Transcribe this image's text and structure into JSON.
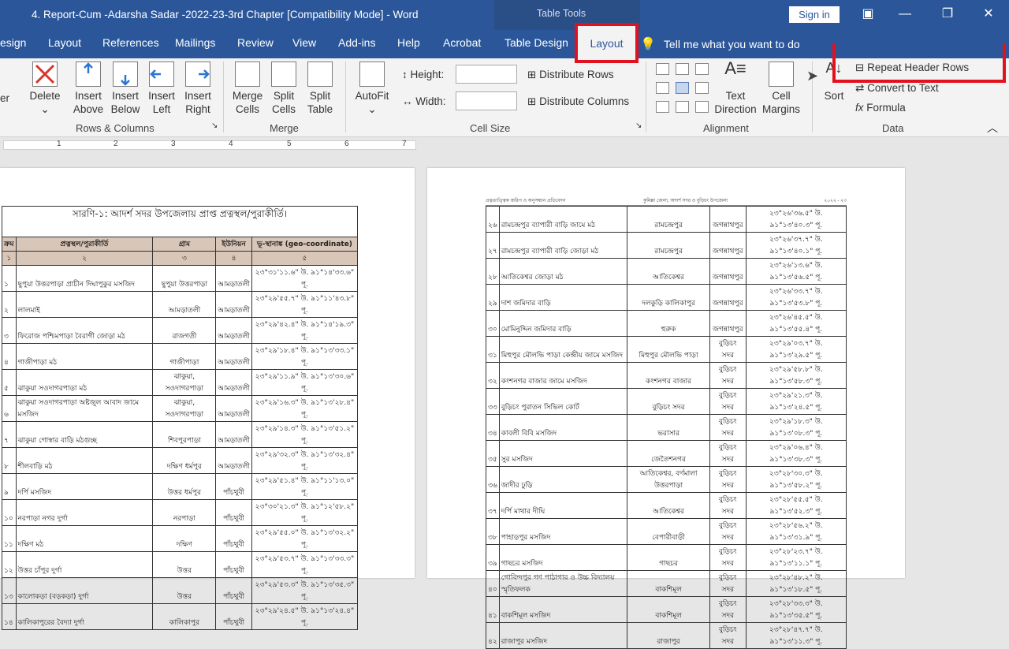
{
  "window": {
    "title": "4. Report-Cum -Adarsha Sadar -2022-23-3rd Chapter [Compatibility Mode]  -  Word",
    "table_tools": "Table Tools",
    "signin": "Sign in"
  },
  "tabs": [
    "esign",
    "Layout",
    "References",
    "Mailings",
    "Review",
    "View",
    "Add-ins",
    "Help",
    "Acrobat",
    "Table Design"
  ],
  "active_tab": "Layout",
  "tellme": "Tell me what you want to do",
  "ribbon": {
    "partial_left": "er",
    "delete": "Delete",
    "insert_above": [
      "Insert",
      "Above"
    ],
    "insert_below": [
      "Insert",
      "Below"
    ],
    "insert_left": [
      "Insert",
      "Left"
    ],
    "insert_right": [
      "Insert",
      "Right"
    ],
    "grp_rows": "Rows & Columns",
    "merge_cells": [
      "Merge",
      "Cells"
    ],
    "split_cells": [
      "Split",
      "Cells"
    ],
    "split_table": [
      "Split",
      "Table"
    ],
    "grp_merge": "Merge",
    "autofit": "AutoFit",
    "height_lbl": "Height:",
    "width_lbl": "Width:",
    "distribute_rows": "Distribute Rows",
    "distribute_cols": "Distribute Columns",
    "grp_cellsize": "Cell Size",
    "text_direction": [
      "Text",
      "Direction"
    ],
    "cell_margins": [
      "Cell",
      "Margins"
    ],
    "grp_alignment": "Alignment",
    "sort": "Sort",
    "repeat_header": "Repeat Header Rows",
    "convert_text": "Convert to Text",
    "formula": "Formula",
    "grp_data": "Data"
  },
  "ruler_ticks": [
    "1",
    "2",
    "3",
    "4",
    "5",
    "6",
    "7"
  ],
  "left_doc": {
    "caption": "সারণি-১: আদর্শ সদর উপজেলায় প্রাপ্ত প্রত্নস্থল/পুরাকীর্তি।",
    "headers": [
      "ক্রম",
      "প্রত্নস্থল/পুরাকীর্তি",
      "গ্রাম",
      "ইউনিয়ন",
      "ভূ-স্থানাঙ্ক (geo-coordinate)"
    ],
    "numrow": [
      "১",
      "২",
      "৩",
      "৪",
      "৫"
    ],
    "rows": [
      [
        "১",
        "ছুপুয়া উত্তরপাড়া প্রাচীন দিঘাপুকুর মসজিদ",
        "ছুপুয়া উত্তরপাড়া",
        "আমড়াতলী",
        "২৩°৩১'১১.৬\" উ. ৯১°১৪'৩৩.৬\" পূ."
      ],
      [
        "২",
        "লালমাই",
        "আমড়াতলী",
        "আমড়াতলী",
        "২৩°২৯'৫৫.৭\" উ. ৯১°১১'৪৩.৮\" পূ."
      ],
      [
        "৩",
        "ফিরোজ পশ্চিমপাড়া বৈরাগী জোড়া মঠ",
        "রাজগতী",
        "আমড়াতলী",
        "২৩°২৯'৪২.৪\" উ. ৯১°১৪'১৯.৩\" পূ."
      ],
      [
        "৪",
        "গাজীপাড়া মঠ",
        "গাজীপাড়া",
        "আমড়াতলী",
        "২৩°২৯'১৮.৪\" উ. ৯১°১৩'৩৩.১\" পূ."
      ],
      [
        "৫",
        "ঝাকুয়া সওদাগরপাড়া মঠ",
        "ঝাকুয়া, সওদাগরপাড়া",
        "আমড়াতলী",
        "২৩°২৯'১১.৯\" উ. ৯১°১৩'৩০.৬\" পূ."
      ],
      [
        "৬",
        "ঝাকুয়া সওদাগরপাড়া অষ্টজুল আবাদ জামে মসজিদ",
        "ঝাকুয়া, সওদাগরপাড়া",
        "আমড়াতলী",
        "২৩°২৯'১৬.৩\" উ. ৯১°১৩'২৮.৪\" পূ."
      ],
      [
        "৭",
        "ঝাকুয়া গোস্বার বাড়ি মঠগুচ্ছ",
        "শিবপুরপাড়া",
        "আমড়াতলী",
        "২৩°২৯'১৪.৩\" উ. ৯১°১৩'৫১.২\" পূ."
      ],
      [
        "৮",
        "শীলবাড়ি মঠ",
        "দক্ষিণ ধর্মপুর",
        "আমড়াতলী",
        "২৩°২৯'৩২.৩\" উ. ৯১°১৩'৩২.৪\" পূ."
      ],
      [
        "৯",
        "দর্পি মসজিদ",
        "উত্তর ধর্মপুর",
        "পাঁচথুবী",
        "২৩°২৯'৫১.৪\" উ. ৯১°১১'১৩.০\" পূ."
      ],
      [
        "১০",
        "নরপাড়া নগর দুর্গা",
        "নরপাড়া",
        "পাঁচথুবী",
        "২৩°৩০'২১.৩\" উ. ৯১°১২'৫৮.২\" পূ."
      ],
      [
        "১১",
        "দক্ষিণ মঠ",
        "দক্ষিণ",
        "পাঁচথুবী",
        "২৩°২৯'৫৫.০\" উ. ৯১°১৩'৩২.২\" পূ."
      ],
      [
        "১২",
        "উত্তর চাঁপুর দুর্গা",
        "উত্তর",
        "পাঁচথুবী",
        "২৩°২৯'৫৩.৭\" উ. ৯১°১৩'৩৩.৩\" পূ."
      ],
      [
        "১৩",
        "কালোকড়া (বড়কড়া) দুর্গা",
        "উত্তর",
        "পাঁচথুবী",
        "২৩°২৯'৫৩.৩\" উ. ৯১°১৩'৩৫.৩\" পূ."
      ],
      [
        "১৪",
        "কালিকাপুরের বৈদ্যা দুর্গা",
        "কালিকাপুর",
        "পাঁচথুবী",
        "২৩°২৯'২৪.৫\" উ. ৯১°১৩'২৪.৪\" পূ."
      ]
    ]
  },
  "right_doc": {
    "header_left": "প্রত্নতাত্ত্বিক জরিপ ও অনুসন্ধান প্রতিবেদন",
    "header_mid": "কুমিল্লা জেলা, আদর্শ সদর ও বুড়িচং উপজেলা",
    "header_right": "২০২২ - ২৩",
    "rows": [
      [
        "২৬",
        "রামচন্দ্রপুর ব্যাপারী বাড়ি জামে মঠ",
        "রামচন্দ্রপুর",
        "জগন্নাথপুর",
        "২৩°২৬'৩৬.৫\" উ. ৯১°১৩'৪০.৩\" পূ."
      ],
      [
        "২৭",
        "রামচন্দ্রপুর ব্যাপারী বাড়ি জোড়া মঠ",
        "রামচন্দ্রপুর",
        "জগন্নাথপুর",
        "২৩°২৬'৩৭.৭\" উ. ৯১°১৩'৪০.১\" পূ."
      ],
      [
        "২৮",
        "আতিকেশ্বর জোড়া মঠ",
        "আতিকেশ্বর",
        "জগন্নাথপুর",
        "২৩°২৬'১৩.৬\" উ. ৯১°১৩'৫৬.৫\" পূ."
      ],
      [
        "২৯",
        "দাশ জমিদার বাড়ি",
        "দলকুড়ি কালিকাপুর",
        "জগন্নাথপুর",
        "২৩°২৬'৩৩.৭\" উ. ৯১°১৩'৫৩.৮\" পূ."
      ],
      [
        "৩০",
        "মোমিনুদ্দিন জমিদার বাড়ি",
        "হুরুক",
        "জগন্নাথপুর",
        "২৩°২৬'৪৫.৫\" উ. ৯১°১৩'৫৫.৪\" পূ."
      ],
      [
        "৩১",
        "মিহুপুর মৌলভি পাড়া কেন্দ্রীয় জামে মসজিদ",
        "মিহুপুর মৌলভি পাড়া",
        "বুড়িচং সদর",
        "২৩°২৯'০৩.৭\" উ. ৯১°১৩'২৯.৫\" পূ."
      ],
      [
        "৩২",
        "কংশনগর বাজার জামে মসজিদ",
        "কংশনগর বাজার",
        "বুড়িচং সদর",
        "২৩°২৯'৫৮.৮\" উ. ৯১°১৩'৫৮.৩\" পূ."
      ],
      [
        "৩৩",
        "বুড়িচং পুরাতন সিভিল কোর্ট",
        "বুড়িচং সদর",
        "বুড়িচং সদর",
        "২৩°২৯'২১.৩\" উ. ৯১°১৩'২৪.৫\" পূ."
      ],
      [
        "৩৪",
        "কাবলী বিবি মসজিদ",
        "ভরাসার",
        "বুড়িচং সদর",
        "২৩°২৯'১৮.৩\" উ. ৯১°১৩'০৮.৩\" পূ."
      ],
      [
        "৩৫",
        "সুর মসজিদ",
        "জেতৈশনগর",
        "বুড়িচং সদর",
        "২৩°২৯'০৬.৪\" উ. ৯১°১৩'৩৮.৩\" পূ."
      ],
      [
        "৩৬",
        "জাদীর ঢুড়ি",
        "আতিকেশ্বর, বর্ণমালা উত্তরপাড়া",
        "বুড়িচং সদর",
        "২৩°২৮'৩০.৩\" উ. ৯১°১৩'৫৮.২\" পূ."
      ],
      [
        "৩৭",
        "দর্পি মাথার দীঘি",
        "আতিকেশ্বর",
        "বুড়িচং সদর",
        "২৩°২৮'৫৫.৫\" উ. ৯১°১৩'৫২.৩\" পূ."
      ],
      [
        "৩৮",
        "পাহাড়পুর মসজিদ",
        "বেপারীবাড়ী",
        "বুড়িচং সদর",
        "২৩°২৮'৫৬.২\" উ. ৯১°১৩'৩১.৯\" পূ."
      ],
      [
        "৩৯",
        "গাছচর মসজিদ",
        "গাছচর",
        "বুড়িচং সদর",
        "২৩°২৮'২৩.৭\" উ. ৯১°১৩'১১.১\" পূ."
      ],
      [
        "৪০",
        "গোবিন্দপুর গণ পাঠাগার ও উচ্চ বিদ্যালয় স্মৃতিফলক",
        "বাকশিমূল",
        "বুড়িচং সদর",
        "২৩°২৮'৪৮.২\" উ. ৯১°১৩'১৮.৫\" পূ."
      ],
      [
        "৪১",
        "বাকশিমূল মসজিদ",
        "বাকশিমূল",
        "বুড়িচং সদর",
        "২৩°২৮'৩৩.৩\" উ. ৯১°১৩'৩৫.৫\" পূ."
      ],
      [
        "৪২",
        "রাজাপুর মসজিদ",
        "রাজাপুর",
        "বুড়িচং সদর",
        "২৩°২৮'৪৭.৭\" উ. ৯১°১৩'১১.৩\" পূ."
      ]
    ]
  }
}
